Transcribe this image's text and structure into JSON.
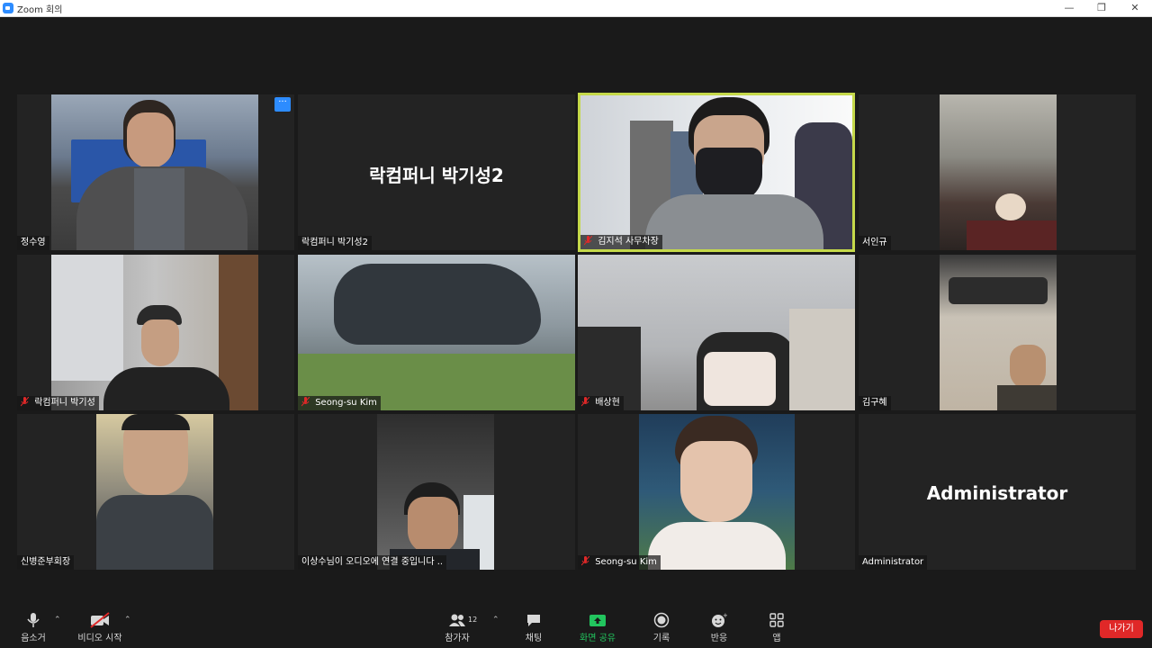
{
  "window": {
    "title": "Zoom 회의",
    "minimize": "—",
    "maximize": "❐",
    "close": "✕"
  },
  "participants": [
    {
      "name": "정수영",
      "muted": false,
      "has_video": true
    },
    {
      "name": "락컴퍼니 박기성2",
      "display_name": "락컴퍼니 박기성2",
      "muted": false,
      "has_video": false
    },
    {
      "name": "김지석 사무차장",
      "muted": true,
      "has_video": true,
      "active_speaker": true
    },
    {
      "name": "서인규",
      "muted": false,
      "has_video": true
    },
    {
      "name": "락컴퍼니 박기성",
      "muted": true,
      "has_video": true
    },
    {
      "name": "Seong-su Kim",
      "muted": true,
      "has_video": true
    },
    {
      "name": "배상현",
      "muted": true,
      "has_video": true
    },
    {
      "name": "김구혜",
      "muted": false,
      "has_video": true
    },
    {
      "name": "신병준부회장",
      "muted": false,
      "has_video": true
    },
    {
      "name": "이상수님이 오디오에 연결 중입니다 ..",
      "muted": false,
      "has_video": true
    },
    {
      "name": "Seong-su Kim",
      "muted": true,
      "has_video": true
    },
    {
      "name": "Administrator",
      "display_name": "Administrator",
      "muted": false,
      "has_video": false
    }
  ],
  "more_button": "···",
  "toolbar": {
    "mute": "음소거",
    "video": "비디오 시작",
    "participants": "참가자",
    "participants_count": "12",
    "chat": "채팅",
    "share": "화면 공유",
    "record": "기록",
    "reactions": "반응",
    "apps": "앱",
    "leave": "나가기"
  },
  "colors": {
    "accent": "#2d8cff",
    "active_border": "#c5d94a",
    "share_green": "#22c55e",
    "leave_red": "#e02828",
    "mute_red": "#e02828"
  }
}
